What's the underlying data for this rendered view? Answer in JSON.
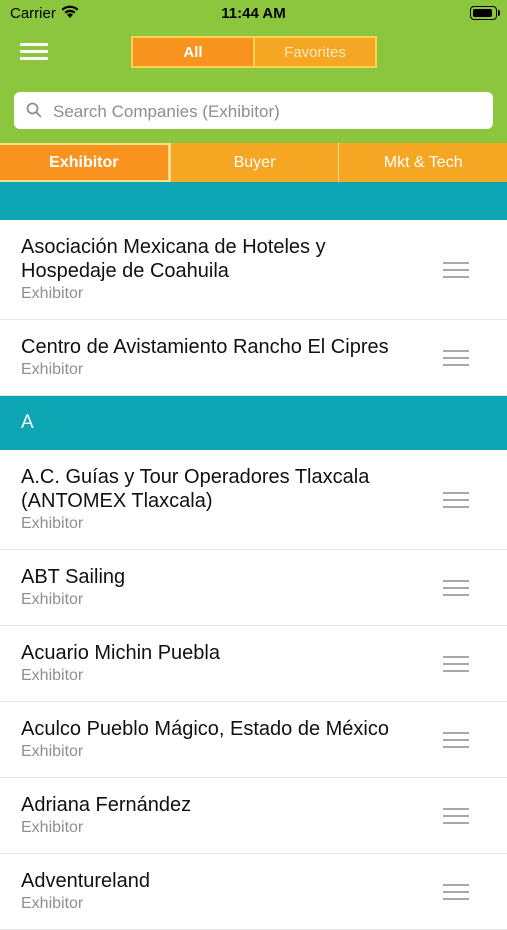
{
  "status": {
    "carrier": "Carrier",
    "time": "11:44 AM"
  },
  "header": {
    "segments": [
      {
        "label": "All",
        "active": true
      },
      {
        "label": "Favorites",
        "active": false
      }
    ]
  },
  "search": {
    "placeholder": "Search Companies (Exhibitor)"
  },
  "tabs": [
    {
      "label": "Exhibitor"
    },
    {
      "label": "Buyer"
    },
    {
      "label": "Mkt & Tech"
    }
  ],
  "colors": {
    "header": "#8cc63f",
    "orange": "#f7931e",
    "section": "#0ea5b5"
  },
  "sections": [
    {
      "title": "",
      "items": [
        {
          "name": "Asociación Mexicana de Hoteles y Hospedaje de Coahuila",
          "type": "Exhibitor"
        },
        {
          "name": "Centro de Avistamiento Rancho El Cipres",
          "type": "Exhibitor"
        }
      ]
    },
    {
      "title": "A",
      "items": [
        {
          "name": "A.C. Guías y Tour Operadores Tlaxcala (ANTOMEX Tlaxcala)",
          "type": "Exhibitor"
        },
        {
          "name": "ABT Sailing",
          "type": "Exhibitor"
        },
        {
          "name": "Acuario Michin Puebla",
          "type": "Exhibitor"
        },
        {
          "name": "Aculco Pueblo Mágico, Estado de México",
          "type": "Exhibitor"
        },
        {
          "name": "Adriana Fernández",
          "type": "Exhibitor"
        },
        {
          "name": "Adventureland",
          "type": "Exhibitor"
        }
      ]
    }
  ]
}
